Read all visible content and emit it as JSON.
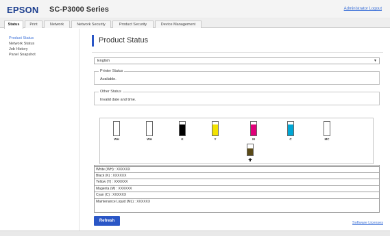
{
  "header": {
    "logo": "EPSON",
    "model": "SC-P3000 Series",
    "admin_link": "Administrator Logout"
  },
  "tabs": [
    {
      "label": "Status",
      "active": true
    },
    {
      "label": "Print",
      "active": false
    },
    {
      "label": "Network",
      "active": false
    },
    {
      "label": "Network Security",
      "active": false
    },
    {
      "label": "Product Security",
      "active": false
    },
    {
      "label": "Device Management",
      "active": false
    }
  ],
  "sidebar": {
    "items": [
      {
        "label": "Product Status",
        "active": true
      },
      {
        "label": "Network Status",
        "active": false
      },
      {
        "label": "Job History",
        "active": false
      },
      {
        "label": "Panel Snapshot",
        "active": false
      }
    ]
  },
  "main": {
    "title": "Product Status",
    "language": {
      "value": "English",
      "arrow": "▼"
    },
    "printer_status": {
      "legend": "Printer Status",
      "value": "Available."
    },
    "other_status": {
      "legend": "Other Status",
      "value": "Invalid date and time."
    },
    "inks": [
      {
        "code": "WH",
        "color": "#ffffff",
        "level": 0.0
      },
      {
        "code": "WH",
        "color": "#ffffff",
        "level": 0.0
      },
      {
        "code": "K",
        "color": "#000000",
        "level": 0.8
      },
      {
        "code": "Y",
        "color": "#f2e200",
        "level": 0.8
      },
      {
        "code": "M",
        "color": "#e0007a",
        "level": 0.8
      },
      {
        "code": "C",
        "color": "#00a7d6",
        "level": 0.8
      },
      {
        "code": "MC",
        "color": "#5a5a5a",
        "level": 0.0
      }
    ],
    "maintenance": {
      "color": "#5a4a18",
      "level": 0.6,
      "icon": "maintenance-box-icon"
    },
    "levels": [
      "White (WH) : XXXXXX",
      "Black (K) : XXXXXX",
      "Yellow (Y) : XXXXXX",
      "Magenta (M) : XXXXXX",
      "Cyan (C) : XXXXXX",
      "Maintenance Liquid (ML) : XXXXXX"
    ],
    "refresh_label": "Refresh",
    "license_link": "Software Licenses"
  },
  "colors": {
    "accent": "#2a56c6",
    "link": "#3a6fd8",
    "logo": "#1d3f8f"
  }
}
